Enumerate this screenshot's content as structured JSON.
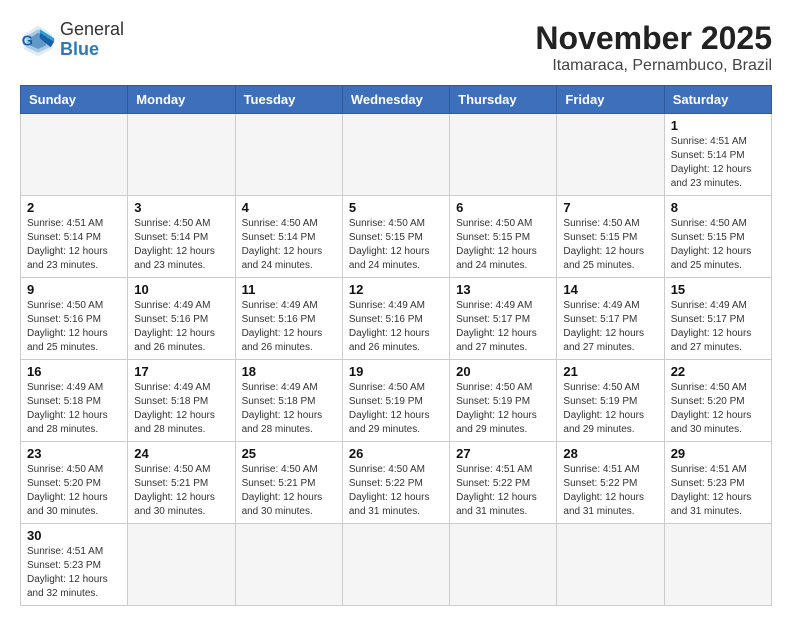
{
  "logo": {
    "line1": "General",
    "line2": "Blue"
  },
  "title": "November 2025",
  "subtitle": "Itamaraca, Pernambuco, Brazil",
  "days_of_week": [
    "Sunday",
    "Monday",
    "Tuesday",
    "Wednesday",
    "Thursday",
    "Friday",
    "Saturday"
  ],
  "weeks": [
    [
      {
        "day": "",
        "info": ""
      },
      {
        "day": "",
        "info": ""
      },
      {
        "day": "",
        "info": ""
      },
      {
        "day": "",
        "info": ""
      },
      {
        "day": "",
        "info": ""
      },
      {
        "day": "",
        "info": ""
      },
      {
        "day": "1",
        "info": "Sunrise: 4:51 AM\nSunset: 5:14 PM\nDaylight: 12 hours and 23 minutes."
      }
    ],
    [
      {
        "day": "2",
        "info": "Sunrise: 4:51 AM\nSunset: 5:14 PM\nDaylight: 12 hours and 23 minutes."
      },
      {
        "day": "3",
        "info": "Sunrise: 4:50 AM\nSunset: 5:14 PM\nDaylight: 12 hours and 23 minutes."
      },
      {
        "day": "4",
        "info": "Sunrise: 4:50 AM\nSunset: 5:14 PM\nDaylight: 12 hours and 24 minutes."
      },
      {
        "day": "5",
        "info": "Sunrise: 4:50 AM\nSunset: 5:15 PM\nDaylight: 12 hours and 24 minutes."
      },
      {
        "day": "6",
        "info": "Sunrise: 4:50 AM\nSunset: 5:15 PM\nDaylight: 12 hours and 24 minutes."
      },
      {
        "day": "7",
        "info": "Sunrise: 4:50 AM\nSunset: 5:15 PM\nDaylight: 12 hours and 25 minutes."
      },
      {
        "day": "8",
        "info": "Sunrise: 4:50 AM\nSunset: 5:15 PM\nDaylight: 12 hours and 25 minutes."
      }
    ],
    [
      {
        "day": "9",
        "info": "Sunrise: 4:50 AM\nSunset: 5:16 PM\nDaylight: 12 hours and 25 minutes."
      },
      {
        "day": "10",
        "info": "Sunrise: 4:49 AM\nSunset: 5:16 PM\nDaylight: 12 hours and 26 minutes."
      },
      {
        "day": "11",
        "info": "Sunrise: 4:49 AM\nSunset: 5:16 PM\nDaylight: 12 hours and 26 minutes."
      },
      {
        "day": "12",
        "info": "Sunrise: 4:49 AM\nSunset: 5:16 PM\nDaylight: 12 hours and 26 minutes."
      },
      {
        "day": "13",
        "info": "Sunrise: 4:49 AM\nSunset: 5:17 PM\nDaylight: 12 hours and 27 minutes."
      },
      {
        "day": "14",
        "info": "Sunrise: 4:49 AM\nSunset: 5:17 PM\nDaylight: 12 hours and 27 minutes."
      },
      {
        "day": "15",
        "info": "Sunrise: 4:49 AM\nSunset: 5:17 PM\nDaylight: 12 hours and 27 minutes."
      }
    ],
    [
      {
        "day": "16",
        "info": "Sunrise: 4:49 AM\nSunset: 5:18 PM\nDaylight: 12 hours and 28 minutes."
      },
      {
        "day": "17",
        "info": "Sunrise: 4:49 AM\nSunset: 5:18 PM\nDaylight: 12 hours and 28 minutes."
      },
      {
        "day": "18",
        "info": "Sunrise: 4:49 AM\nSunset: 5:18 PM\nDaylight: 12 hours and 28 minutes."
      },
      {
        "day": "19",
        "info": "Sunrise: 4:50 AM\nSunset: 5:19 PM\nDaylight: 12 hours and 29 minutes."
      },
      {
        "day": "20",
        "info": "Sunrise: 4:50 AM\nSunset: 5:19 PM\nDaylight: 12 hours and 29 minutes."
      },
      {
        "day": "21",
        "info": "Sunrise: 4:50 AM\nSunset: 5:19 PM\nDaylight: 12 hours and 29 minutes."
      },
      {
        "day": "22",
        "info": "Sunrise: 4:50 AM\nSunset: 5:20 PM\nDaylight: 12 hours and 30 minutes."
      }
    ],
    [
      {
        "day": "23",
        "info": "Sunrise: 4:50 AM\nSunset: 5:20 PM\nDaylight: 12 hours and 30 minutes."
      },
      {
        "day": "24",
        "info": "Sunrise: 4:50 AM\nSunset: 5:21 PM\nDaylight: 12 hours and 30 minutes."
      },
      {
        "day": "25",
        "info": "Sunrise: 4:50 AM\nSunset: 5:21 PM\nDaylight: 12 hours and 30 minutes."
      },
      {
        "day": "26",
        "info": "Sunrise: 4:50 AM\nSunset: 5:22 PM\nDaylight: 12 hours and 31 minutes."
      },
      {
        "day": "27",
        "info": "Sunrise: 4:51 AM\nSunset: 5:22 PM\nDaylight: 12 hours and 31 minutes."
      },
      {
        "day": "28",
        "info": "Sunrise: 4:51 AM\nSunset: 5:22 PM\nDaylight: 12 hours and 31 minutes."
      },
      {
        "day": "29",
        "info": "Sunrise: 4:51 AM\nSunset: 5:23 PM\nDaylight: 12 hours and 31 minutes."
      }
    ],
    [
      {
        "day": "30",
        "info": "Sunrise: 4:51 AM\nSunset: 5:23 PM\nDaylight: 12 hours and 32 minutes."
      },
      {
        "day": "",
        "info": ""
      },
      {
        "day": "",
        "info": ""
      },
      {
        "day": "",
        "info": ""
      },
      {
        "day": "",
        "info": ""
      },
      {
        "day": "",
        "info": ""
      },
      {
        "day": "",
        "info": ""
      }
    ]
  ]
}
